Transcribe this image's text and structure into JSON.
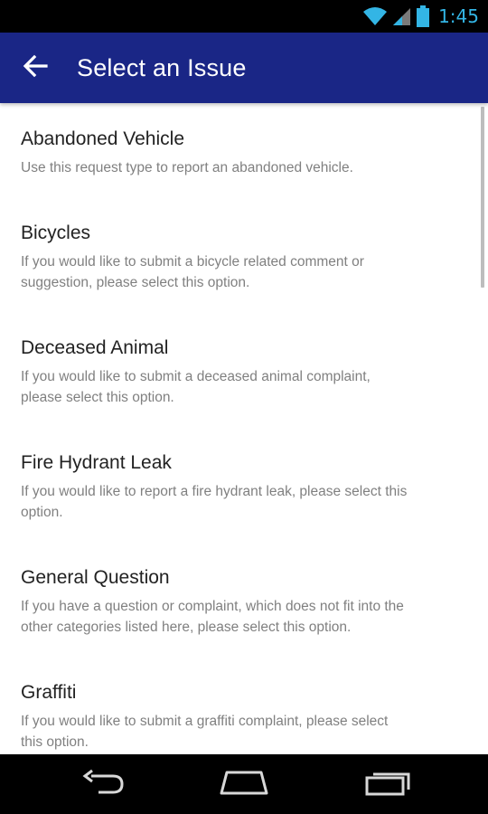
{
  "status_bar": {
    "time": "1:45",
    "icons": [
      "wifi-icon",
      "signal-icon",
      "battery-icon"
    ],
    "accent_color": "#33b5e5"
  },
  "app_bar": {
    "title": "Select an Issue",
    "back_icon": "arrow-left-icon",
    "background_color": "#1a2686"
  },
  "issues": [
    {
      "title": "Abandoned Vehicle",
      "lines": [
        "Use this request type to report an abandoned vehicle."
      ]
    },
    {
      "title": "Bicycles",
      "lines": [
        "If you would like to submit a bicycle related comment or",
        "suggestion, please select this option."
      ]
    },
    {
      "title": "Deceased Animal",
      "lines": [
        "If you would like to submit a deceased animal complaint,",
        "please select this option."
      ]
    },
    {
      "title": "Fire Hydrant Leak",
      "lines": [
        "If you would like to report a fire hydrant leak, please select this",
        "option."
      ]
    },
    {
      "title": "General Question",
      "lines": [
        "If you have a question or complaint, which does not fit into the",
        "other categories listed here, please select this option."
      ]
    },
    {
      "title": "Graffiti",
      "lines": [
        "If you would like to submit a graffiti complaint, please select",
        "this option."
      ]
    }
  ],
  "nav_bar": {
    "buttons": [
      "back-icon",
      "home-icon",
      "recents-icon"
    ]
  }
}
